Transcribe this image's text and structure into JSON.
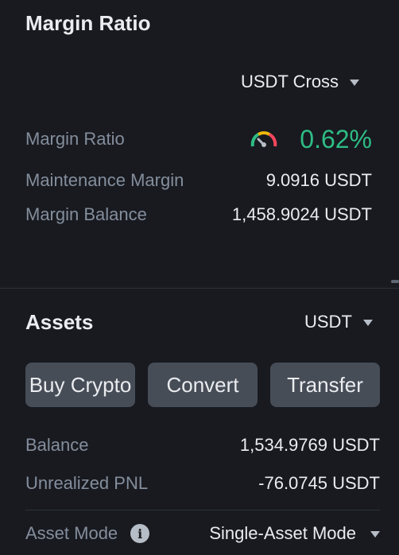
{
  "margin_section": {
    "title": "Margin Ratio",
    "mode_selector": "USDT Cross",
    "rows": [
      {
        "label": "Margin Ratio",
        "value": "0.62%"
      },
      {
        "label": "Maintenance Margin",
        "value": "9.0916 USDT"
      },
      {
        "label": "Margin Balance",
        "value": "1,458.9024 USDT"
      }
    ],
    "gauge_icon": "gauge-icon",
    "ratio_color": "#2EBD85"
  },
  "assets_section": {
    "title": "Assets",
    "currency_selector": "USDT",
    "buttons": [
      "Buy Crypto",
      "Convert",
      "Transfer"
    ],
    "rows": [
      {
        "label": "Balance",
        "value": "1,534.9769 USDT"
      },
      {
        "label": "Unrealized PNL",
        "value": "-76.0745 USDT"
      }
    ],
    "asset_mode": {
      "label": "Asset Mode",
      "info_icon": "info-icon",
      "value": "Single-Asset Mode"
    }
  }
}
